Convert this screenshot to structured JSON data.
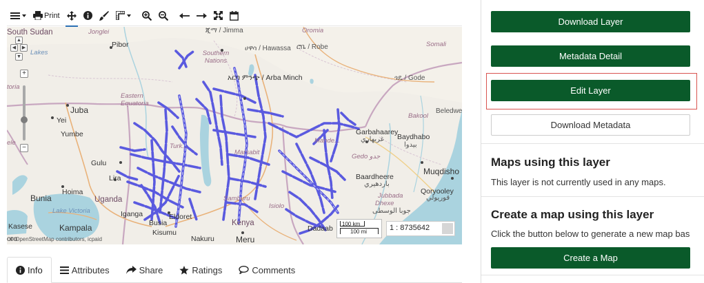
{
  "toolbar": {
    "print_label": "Print"
  },
  "map": {
    "labels": {
      "south_sudan": "South Sudan",
      "jonglei": "Jonglei",
      "jimma": "ጂማ / Jimma",
      "oromia": "Oromia",
      "hawassa": "ሀዋሳ / Hawassa",
      "robe": "ሮቤ / Robe",
      "somali": "Somali",
      "pibor": "Pibor",
      "southern_nations": "Southern Nations",
      "lakes": "Lakes",
      "arba_minch": "አርባ ምንጭ / Arba Minch",
      "gode": "ጎዴ / Gode",
      "toria": "toria",
      "eastern_equatoria": "Eastern Equatoria",
      "juba": "Juba",
      "beledweyne": "Beledwe",
      "bakool": "Bakool",
      "ele": "ele",
      "yei": "Yei",
      "yumbe": "Yumbe",
      "turkana": "Turk...",
      "garbahaarey": "Garbahaarey",
      "garbahaarey_ar": "غربهاري",
      "baydhabo": "Baydhabo",
      "baydhabo_ar": "بيدوا",
      "mandera": "Mande...",
      "gedo": "Gedo",
      "gedo_ar": "جدو",
      "gulu": "Gulu",
      "lira": "Lira",
      "marsabit": "Marsabit",
      "baardheere": "Baardheere",
      "baardheere_ar": "باردهيري",
      "muqdisho": "Muqdisho",
      "qoryooley": "Qoryooley",
      "qoryooley_ar": "قوريولي",
      "hoima": "Hoima",
      "bunia": "Bunia",
      "uganda": "Uganda",
      "samburu": "Samburu",
      "isiolo": "Isiolo",
      "jubbada": "Jubbada",
      "dhexe": "Dhexe",
      "dhexe_ar": "جوبا الوسطى",
      "lake_victoria": "Lake Victoria",
      "iganga": "Iganga",
      "busia": "Busia",
      "eldoret": "Eldoret",
      "kenya": "Kenya",
      "dadaab": "Dadaab",
      "kasese": "Kasese",
      "kampala": "Kampala",
      "kisumu": "Kisumu",
      "nakuru": "Nakuru",
      "meru": "Meru",
      "toro": "oro"
    },
    "scale_km": "100 km",
    "scale_mi": "100 mi",
    "scale_ratio": "1 : 8735642",
    "attribution": "© OpenStreetMap contributors, icpaid"
  },
  "tabs": [
    {
      "label": "Info",
      "icon": "info-icon"
    },
    {
      "label": "Attributes",
      "icon": "list-icon"
    },
    {
      "label": "Share",
      "icon": "share-icon"
    },
    {
      "label": "Ratings",
      "icon": "star-icon"
    },
    {
      "label": "Comments",
      "icon": "comment-icon"
    }
  ],
  "sidebar": {
    "download_layer": "Download Layer",
    "metadata_detail": "Metadata Detail",
    "edit_layer": "Edit Layer",
    "download_metadata": "Download Metadata",
    "maps_title": "Maps using this layer",
    "maps_text": "This layer is not currently used in any maps.",
    "create_title": "Create a map using this layer",
    "create_text": "Click the button below to generate a new map bas",
    "create_button": "Create a Map"
  },
  "colors": {
    "button_green": "#0a5a2a",
    "road_blue": "#5a5adf",
    "highlight_red": "#d9534f",
    "water": "#aad3df"
  }
}
